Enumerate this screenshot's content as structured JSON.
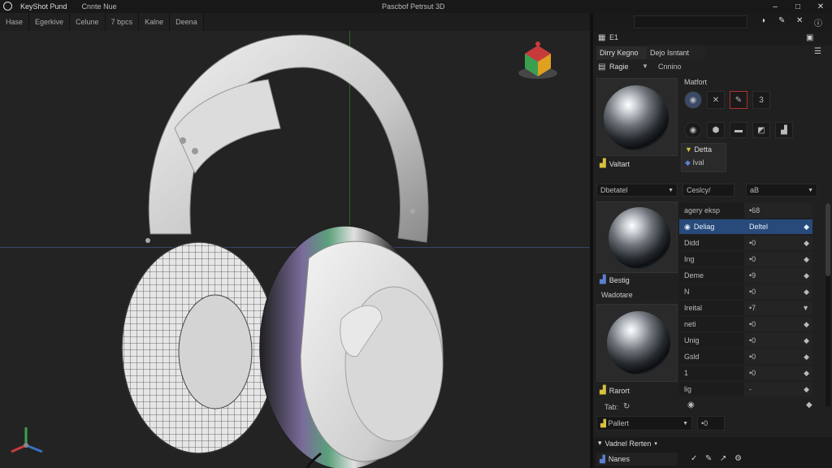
{
  "window": {
    "app_name": "KeyShot Pund",
    "menu_title": "Cnnte Nue",
    "center_title": "Pascbof Petrsut 3D",
    "controls": [
      "–",
      "□",
      "✕"
    ]
  },
  "menubar": {
    "items": [
      "Hase",
      "Egerkive",
      "Celune",
      "7 bpcs",
      "Kalne",
      "Deena"
    ]
  },
  "panel": {
    "top_icons_label": "E1",
    "tabs": [
      "Dirry Kegno",
      "Dejo Isntant"
    ],
    "subtabs": [
      "Ragie",
      "Cnnino"
    ],
    "material_heading": "Matfort",
    "preview_label": "Valtart",
    "swatch_buttons_row1": [
      "◉",
      "✕",
      "✎",
      "3"
    ],
    "swatch_buttons_row2": [
      "◉",
      "⬢",
      "▬",
      "◩",
      "▟"
    ],
    "tag_items": [
      "Detta",
      "Ival"
    ],
    "dropdown1": "Dbetatel",
    "dropdown2": "Ceslcy/",
    "dropdown3": "aB",
    "props": [
      {
        "key": "agery eksp",
        "value": "•68",
        "selected": false
      },
      {
        "key": "Deliag",
        "value": "Deltel",
        "selected": true
      },
      {
        "key": "Didd",
        "value": "•0",
        "selected": false
      },
      {
        "key": "Ing",
        "value": "•0",
        "selected": false
      },
      {
        "key": "Deme",
        "value": "•9",
        "selected": false
      },
      {
        "key": "N",
        "value": "•0",
        "selected": false
      },
      {
        "key": "Ireital",
        "value": "•7",
        "selected": false
      },
      {
        "key": "neti",
        "value": "•0",
        "selected": false
      },
      {
        "key": "Unig",
        "value": "•0",
        "selected": false
      },
      {
        "key": "Gsld",
        "value": "•0",
        "selected": false
      },
      {
        "key": "1",
        "value": "•0",
        "selected": false
      },
      {
        "key": "lig",
        "value": "-",
        "selected": false
      }
    ],
    "thumb1_label": "Bestig",
    "thumb_section_label": "Wadotare",
    "thumb2_label": "Rarort",
    "tab_label": "Tab:",
    "bottom_dropdown": "Pallert",
    "bottom_value": "•0",
    "footer_title": "Vadnel Rerten",
    "footer_item": "Nanes"
  },
  "colors": {
    "accent": "#274a7a",
    "panel_bg": "#202020",
    "viewport_bg": "#232323",
    "axis_green": "#2e6a1d",
    "axis_blue": "#3a4468"
  }
}
